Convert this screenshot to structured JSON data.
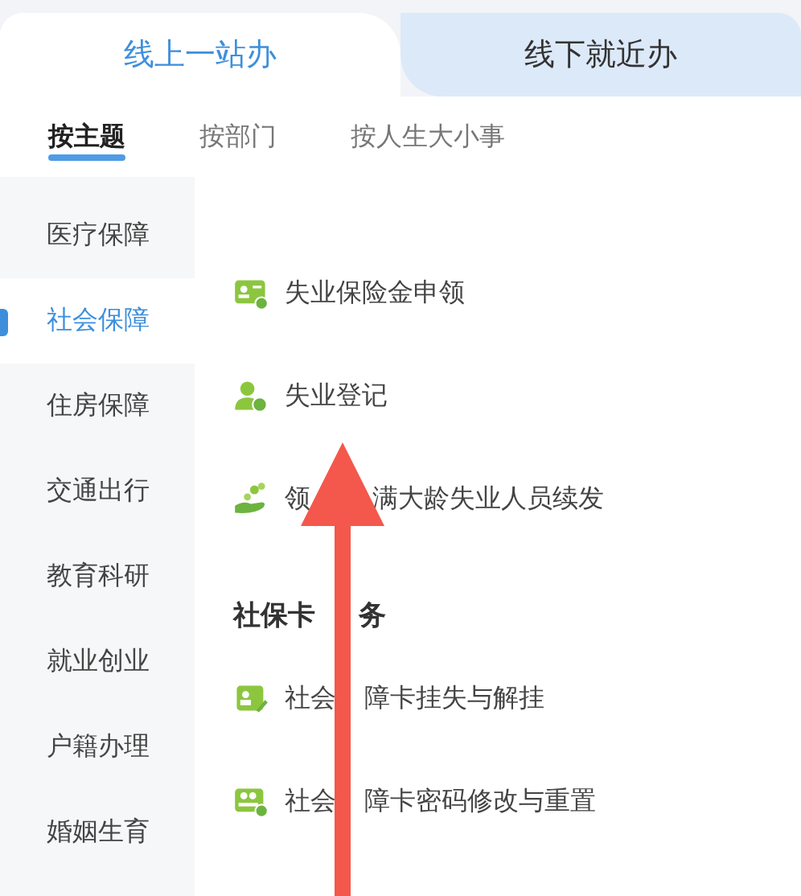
{
  "tabs": [
    {
      "label": "线上一站办",
      "selected": true
    },
    {
      "label": "线下就近办",
      "selected": false
    }
  ],
  "subtabs": [
    {
      "label": "按主题",
      "selected": true
    },
    {
      "label": "按部门",
      "selected": false
    },
    {
      "label": "按人生大小事",
      "selected": false
    }
  ],
  "sidebar": {
    "items": [
      {
        "label": "医疗保障",
        "selected": false
      },
      {
        "label": "社会保障",
        "selected": true
      },
      {
        "label": "住房保障",
        "selected": false
      },
      {
        "label": "交通出行",
        "selected": false
      },
      {
        "label": "教育科研",
        "selected": false
      },
      {
        "label": "就业创业",
        "selected": false
      },
      {
        "label": "户籍办理",
        "selected": false
      },
      {
        "label": "婚姻生育",
        "selected": false
      }
    ]
  },
  "content": [
    {
      "kind": "item",
      "parts": [
        "失业保险金申领"
      ]
    },
    {
      "kind": "item",
      "parts": [
        "失业登记"
      ]
    },
    {
      "kind": "item",
      "parts": [
        "领",
        "满大龄失业人员续发"
      ]
    },
    {
      "kind": "heading",
      "parts": [
        "社保卡",
        "务"
      ]
    },
    {
      "kind": "item",
      "parts": [
        "社会",
        "障卡挂失与解挂"
      ]
    },
    {
      "kind": "item",
      "parts": [
        "社会",
        "障卡密码修改与重置"
      ]
    }
  ]
}
